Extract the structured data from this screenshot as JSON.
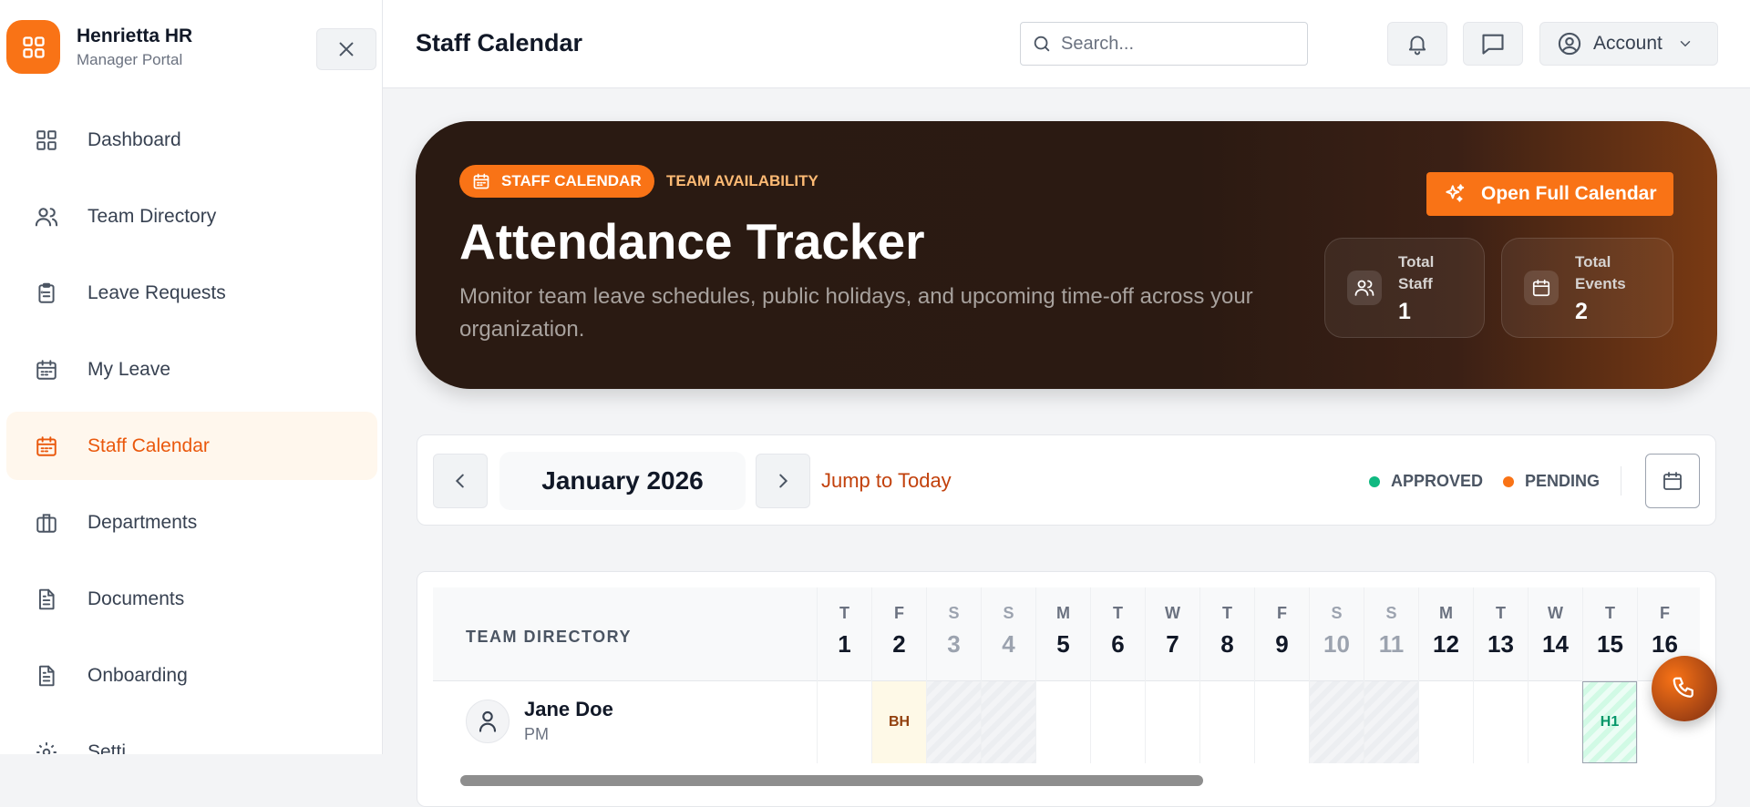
{
  "brand": {
    "name": "Henrietta HR",
    "subtitle": "Manager Portal"
  },
  "sidebar": {
    "items": [
      {
        "label": "Dashboard",
        "icon": "grid-icon"
      },
      {
        "label": "Team Directory",
        "icon": "users-icon"
      },
      {
        "label": "Leave Requests",
        "icon": "clipboard-icon"
      },
      {
        "label": "My Leave",
        "icon": "calendar-icon"
      },
      {
        "label": "Staff Calendar",
        "icon": "calendar-icon",
        "active": true
      },
      {
        "label": "Departments",
        "icon": "briefcase-icon"
      },
      {
        "label": "Documents",
        "icon": "document-icon"
      },
      {
        "label": "Onboarding",
        "icon": "document-icon"
      },
      {
        "label": "Setti",
        "icon": "gear-icon"
      }
    ]
  },
  "header": {
    "title": "Staff Calendar",
    "search_placeholder": "Search...",
    "account_label": "Account"
  },
  "hero": {
    "badge": "STAFF CALENDAR",
    "tag": "TEAM AVAILABILITY",
    "title": "Attendance Tracker",
    "description": "Monitor team leave schedules, public holidays, and upcoming time-off across your organization.",
    "button": "Open Full Calendar",
    "stats": [
      {
        "label": "Total Staff",
        "value": "1",
        "icon": "users-icon"
      },
      {
        "label": "Total Events",
        "value": "2",
        "icon": "calendar-icon"
      }
    ]
  },
  "calendar_nav": {
    "month": "January 2026",
    "jump_label": "Jump to Today",
    "legend": [
      {
        "label": "APPROVED",
        "color": "#10b981"
      },
      {
        "label": "PENDING",
        "color": "#f97316"
      }
    ]
  },
  "grid": {
    "team_header": "TEAM DIRECTORY",
    "days": [
      {
        "dow": "T",
        "num": "1",
        "weekend": false
      },
      {
        "dow": "F",
        "num": "2",
        "weekend": false
      },
      {
        "dow": "S",
        "num": "3",
        "weekend": true
      },
      {
        "dow": "S",
        "num": "4",
        "weekend": true
      },
      {
        "dow": "M",
        "num": "5",
        "weekend": false
      },
      {
        "dow": "T",
        "num": "6",
        "weekend": false
      },
      {
        "dow": "W",
        "num": "7",
        "weekend": false
      },
      {
        "dow": "T",
        "num": "8",
        "weekend": false
      },
      {
        "dow": "F",
        "num": "9",
        "weekend": false
      },
      {
        "dow": "S",
        "num": "10",
        "weekend": true
      },
      {
        "dow": "S",
        "num": "11",
        "weekend": true
      },
      {
        "dow": "M",
        "num": "12",
        "weekend": false
      },
      {
        "dow": "T",
        "num": "13",
        "weekend": false
      },
      {
        "dow": "W",
        "num": "14",
        "weekend": false
      },
      {
        "dow": "T",
        "num": "15",
        "weekend": false
      },
      {
        "dow": "F",
        "num": "16",
        "weekend": false
      }
    ],
    "employee": {
      "name": "Jane Doe",
      "role": "PM"
    },
    "events": [
      {
        "day": "2",
        "code": "BH",
        "kind": "bh"
      },
      {
        "day": "15",
        "code": "H1",
        "kind": "h1"
      }
    ]
  }
}
